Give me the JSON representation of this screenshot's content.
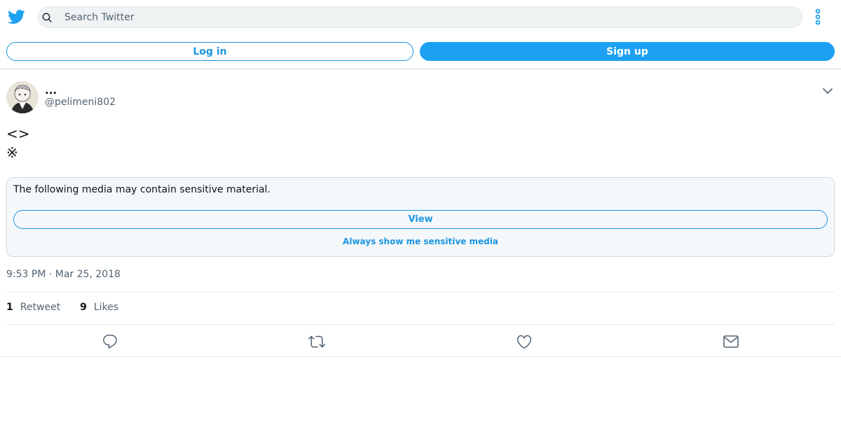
{
  "header": {
    "logo": "twitter-bird-icon",
    "search_placeholder": "Search Twitter",
    "more_icon": "more-vertical-icon",
    "login_label": "Log in",
    "signup_label": "Sign up"
  },
  "tweet": {
    "display_name": "...",
    "handle": "@pelimeni802",
    "text": "<>\n※",
    "sensitive_message": "The following media may contain sensitive material.",
    "view_label": "View",
    "always_show_label": "Always show me sensitive media",
    "timestamp": "9:53 PM · Mar 25, 2018",
    "stats": {
      "retweets_count": "1",
      "retweets_label": "Retweet",
      "likes_count": "9",
      "likes_label": "Likes"
    }
  },
  "actions": [
    "reply-icon",
    "retweet-icon",
    "like-icon",
    "share-mail-icon"
  ],
  "colors": {
    "brand": "#1da1f2",
    "link": "#1b95e0",
    "secondary_text": "#536471",
    "border": "#cfd9de"
  }
}
